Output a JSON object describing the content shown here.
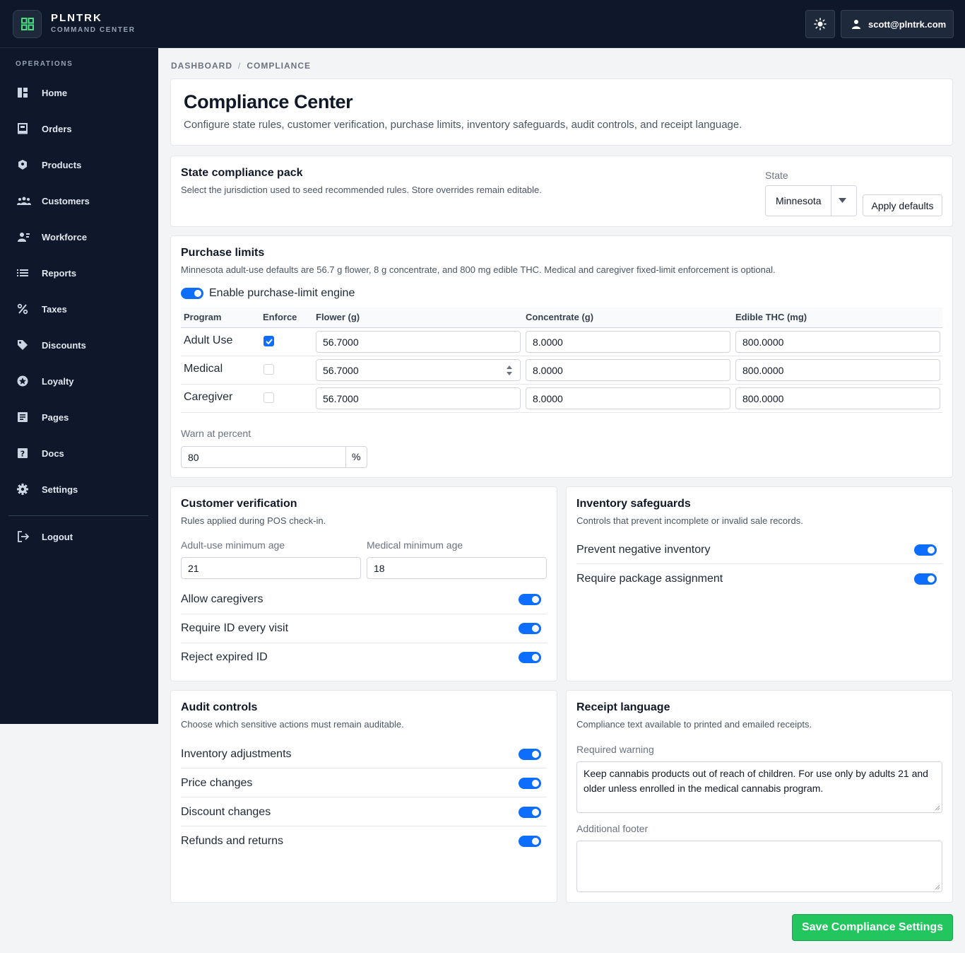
{
  "brand": {
    "name": "PLNTRK",
    "subtitle": "COMMAND CENTER"
  },
  "header": {
    "user_email": "scott@plntrk.com"
  },
  "sidebar": {
    "section": "OPERATIONS",
    "items": [
      {
        "label": "Home",
        "icon": "dashboard-icon"
      },
      {
        "label": "Orders",
        "icon": "register-icon"
      },
      {
        "label": "Products",
        "icon": "product-icon"
      },
      {
        "label": "Customers",
        "icon": "users-icon"
      },
      {
        "label": "Workforce",
        "icon": "workforce-icon"
      },
      {
        "label": "Reports",
        "icon": "list-icon"
      },
      {
        "label": "Taxes",
        "icon": "percent-icon"
      },
      {
        "label": "Discounts",
        "icon": "tag-icon"
      },
      {
        "label": "Loyalty",
        "icon": "star-icon"
      },
      {
        "label": "Pages",
        "icon": "page-icon"
      },
      {
        "label": "Docs",
        "icon": "help-icon"
      },
      {
        "label": "Settings",
        "icon": "gear-icon"
      }
    ],
    "logout": "Logout"
  },
  "breadcrumb": {
    "items": [
      "DASHBOARD",
      "COMPLIANCE"
    ],
    "separator": "/"
  },
  "hero": {
    "title": "Compliance Center",
    "description": "Configure state rules, customer verification, purchase limits, inventory safeguards, audit controls, and receipt language."
  },
  "state_pack": {
    "title": "State compliance pack",
    "description": "Select the jurisdiction used to seed recommended rules. Store overrides remain editable.",
    "state_label": "State",
    "state_value": "Minnesota",
    "apply_label": "Apply defaults"
  },
  "purchase_limits": {
    "title": "Purchase limits",
    "description": "Minnesota adult-use defaults are 56.7 g flower, 8 g concentrate, and 800 mg edible THC. Medical and caregiver fixed-limit enforcement is optional.",
    "engine_label": "Enable purchase-limit engine",
    "engine_enabled": true,
    "columns": [
      "Program",
      "Enforce",
      "Flower (g)",
      "Concentrate (g)",
      "Edible THC (mg)"
    ],
    "rows": [
      {
        "program": "Adult Use",
        "enforce": true,
        "flower": "56.7000",
        "concentrate": "8.0000",
        "edible": "800.0000"
      },
      {
        "program": "Medical",
        "enforce": false,
        "flower": "56.7000",
        "concentrate": "8.0000",
        "edible": "800.0000"
      },
      {
        "program": "Caregiver",
        "enforce": false,
        "flower": "56.7000",
        "concentrate": "8.0000",
        "edible": "800.0000"
      }
    ],
    "warn_label": "Warn at percent",
    "warn_value": "80",
    "warn_unit": "%"
  },
  "customer_verification": {
    "title": "Customer verification",
    "description": "Rules applied during POS check-in.",
    "adult_age_label": "Adult-use minimum age",
    "adult_age_value": "21",
    "medical_age_label": "Medical minimum age",
    "medical_age_value": "18",
    "toggles": [
      {
        "label": "Allow caregivers",
        "on": true
      },
      {
        "label": "Require ID every visit",
        "on": true
      },
      {
        "label": "Reject expired ID",
        "on": true
      }
    ]
  },
  "inventory_safeguards": {
    "title": "Inventory safeguards",
    "description": "Controls that prevent incomplete or invalid sale records.",
    "toggles": [
      {
        "label": "Prevent negative inventory",
        "on": true
      },
      {
        "label": "Require package assignment",
        "on": true
      }
    ]
  },
  "audit_controls": {
    "title": "Audit controls",
    "description": "Choose which sensitive actions must remain auditable.",
    "toggles": [
      {
        "label": "Inventory adjustments",
        "on": true
      },
      {
        "label": "Price changes",
        "on": true
      },
      {
        "label": "Discount changes",
        "on": true
      },
      {
        "label": "Refunds and returns",
        "on": true
      }
    ]
  },
  "receipt_language": {
    "title": "Receipt language",
    "description": "Compliance text available to printed and emailed receipts.",
    "warning_label": "Required warning",
    "warning_value": "Keep cannabis products out of reach of children. For use only by adults 21 and older unless enrolled in the medical cannabis program.",
    "footer_label": "Additional footer",
    "footer_value": ""
  },
  "save_label": "Save Compliance Settings",
  "colors": {
    "primary": "#0d6efd",
    "success": "#22c55e",
    "navy": "#0f172a",
    "brand_green": "#4ade80"
  }
}
